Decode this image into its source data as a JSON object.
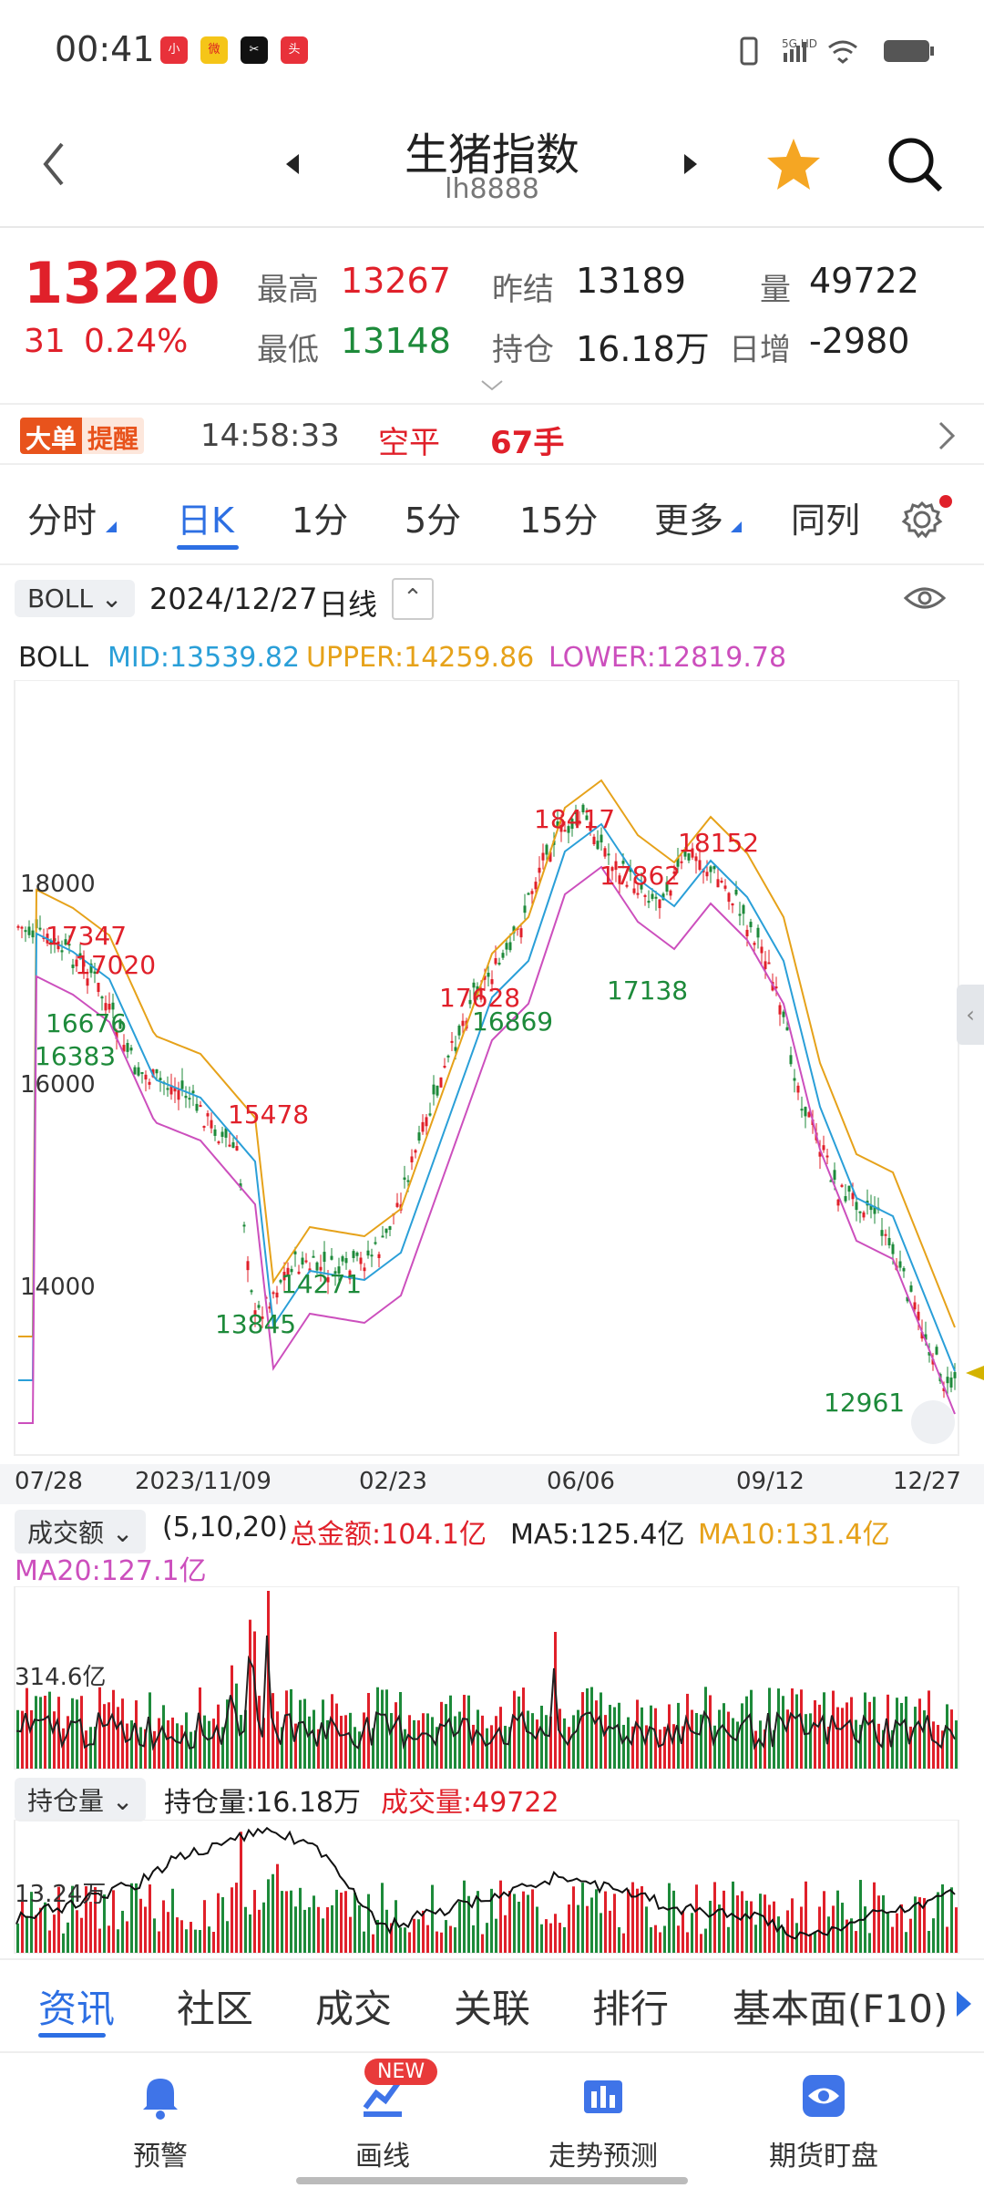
{
  "status": {
    "time": "00:41",
    "network": "5G HD",
    "app_icons": [
      "小红书",
      "微博",
      "剪映",
      "头条"
    ]
  },
  "header": {
    "title": "生猪指数",
    "code": "lh8888"
  },
  "quote": {
    "price": "13220",
    "change": "31",
    "change_pct": "0.24%",
    "high_label": "最高",
    "high": "13267",
    "low_label": "最低",
    "low": "13148",
    "prev_settle_label": "昨结",
    "prev_settle": "13189",
    "open_int_label": "持仓",
    "open_int": "16.18万",
    "volume_label": "量",
    "volume": "49722",
    "daily_add_label": "日增",
    "daily_add": "-2980"
  },
  "alert": {
    "badge1": "大单",
    "badge2": "提醒",
    "time": "14:58:33",
    "type": "空平",
    "qty": "67手"
  },
  "tabs": [
    "分时",
    "日K",
    "1分",
    "5分",
    "15分",
    "更多",
    "同列"
  ],
  "active_tab": "日K",
  "kline": {
    "indicator": "BOLL",
    "date": "2024/12/27",
    "period": "日线",
    "boll_name": "BOLL",
    "mid": "MID:13539.82",
    "upper": "UPPER:14259.86",
    "lower": "LOWER:12819.78",
    "y_labels": [
      "18000",
      "16000",
      "14000"
    ],
    "x_labels": [
      "07/28",
      "2023/11/09",
      "02/23",
      "06/06",
      "09/12",
      "12/27"
    ],
    "annotations": {
      "a17347": "17347",
      "a17020": "17020",
      "a16676": "16676",
      "a16383": "16383",
      "a15478": "15478",
      "a13845": "13845",
      "a14271": "14271",
      "a17628": "17628",
      "a16869": "16869",
      "a18417": "18417",
      "a17862": "17862",
      "a18152": "18152",
      "a17138": "17138",
      "a12961": "12961"
    }
  },
  "turnover": {
    "indicator": "成交额",
    "params": "(5,10,20)",
    "total": "总金额:104.1亿",
    "ma5": "MA5:125.4亿",
    "ma10": "MA10:131.4亿",
    "ma20": "MA20:127.1亿",
    "y_label": "314.6亿"
  },
  "openint": {
    "indicator": "持仓量",
    "oi": "持仓量:16.18万",
    "vol": "成交量:49722",
    "y_label": "13.24万"
  },
  "bottom_tabs": [
    "资讯",
    "社区",
    "成交",
    "关联",
    "排行",
    "基本面(F10)"
  ],
  "bottom_nav": [
    {
      "label": "预警",
      "icon": "bell-icon"
    },
    {
      "label": "画线",
      "icon": "draw-line-icon",
      "badge": "NEW"
    },
    {
      "label": "走势预测",
      "icon": "forecast-icon"
    },
    {
      "label": "期货盯盘",
      "icon": "eye-icon"
    }
  ],
  "colors": {
    "up": "#e0202a",
    "down": "#1d8a3a",
    "mid": "#2a9fd8",
    "upper": "#e6a21a",
    "lower": "#cc4fbd",
    "active": "#2d6fe3"
  }
}
